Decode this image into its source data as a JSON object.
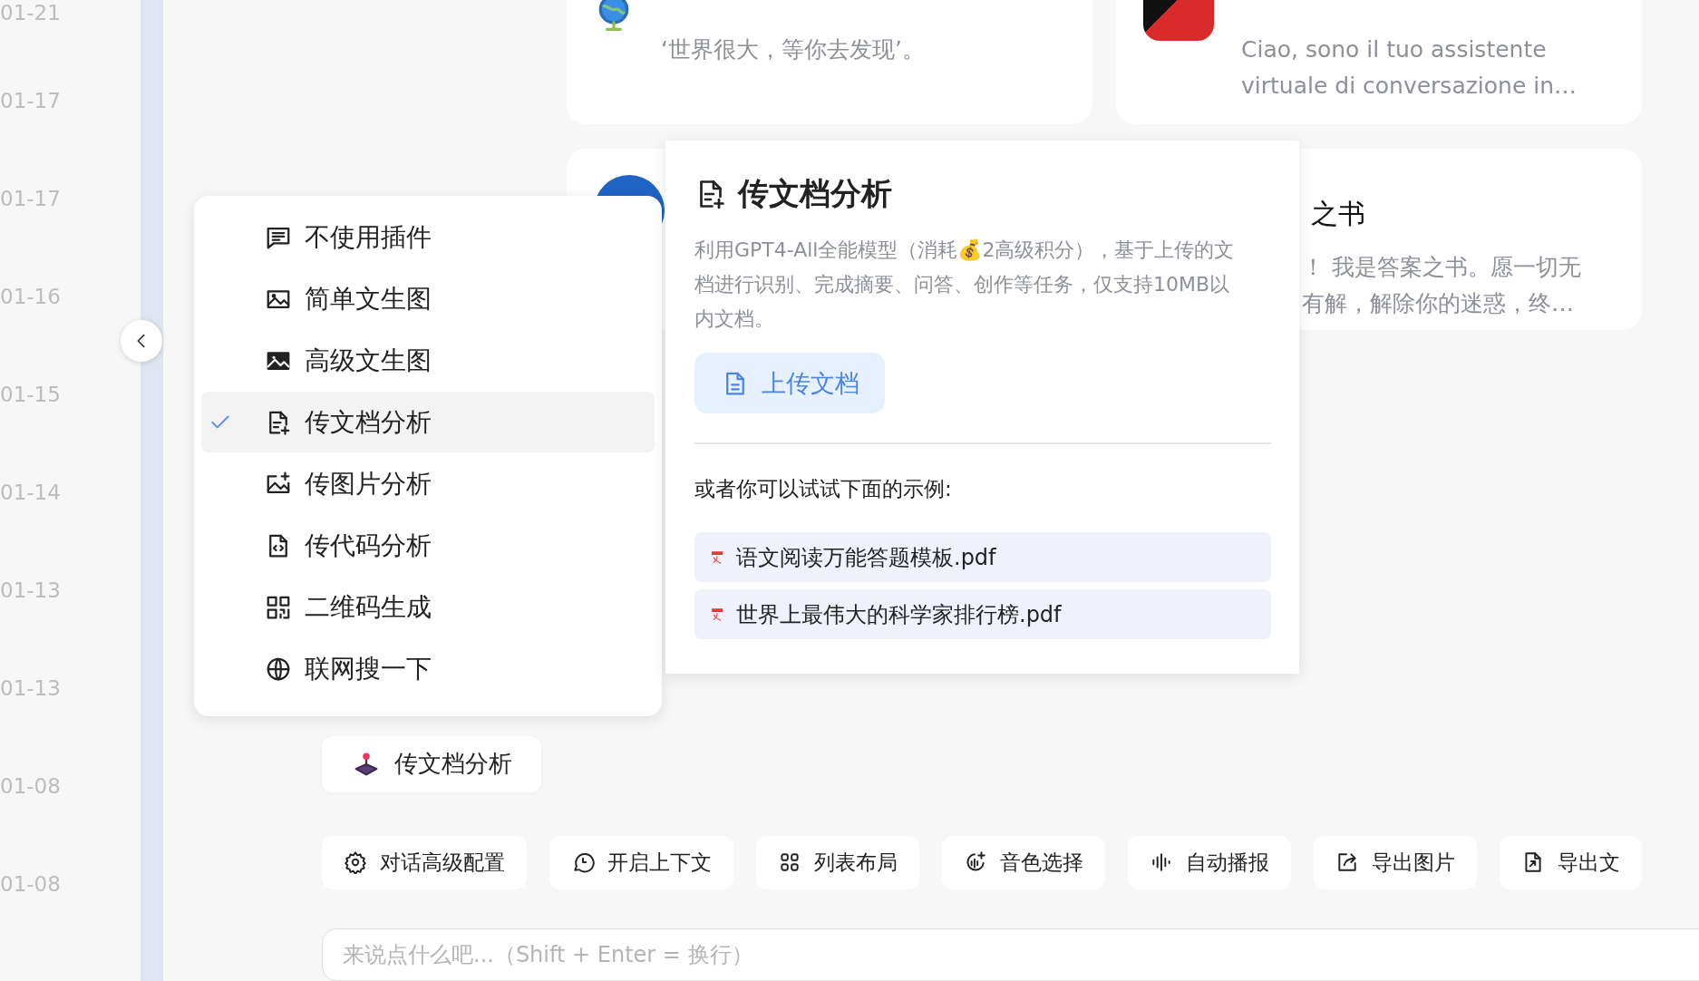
{
  "dates": [
    "01-21",
    "01-17",
    "01-17",
    "01-16",
    "01-15",
    "01-14",
    "01-13",
    "01-13",
    "01-08",
    "01-08"
  ],
  "cards": [
    {
      "kind": "globe",
      "description_lines": [
        "‘世界很大，等你去发现’。"
      ]
    },
    {
      "kind": "app",
      "description_lines": [
        "Ciao, sono il tuo assistente",
        "virtuale di conversazione in…"
      ]
    },
    {
      "kind": "avatar"
    },
    {
      "kind": "text",
      "title": "之书",
      "description_lines": [
        "！ 我是答案之书。愿一切无",
        "有解，解除你的迷惑，终…"
      ]
    }
  ],
  "plugin_menu": {
    "items": [
      {
        "label": "不使用插件",
        "selected": false
      },
      {
        "label": "简单文生图",
        "selected": false
      },
      {
        "label": "高级文生图",
        "selected": false
      },
      {
        "label": "传文档分析",
        "selected": true
      },
      {
        "label": "传图片分析",
        "selected": false
      },
      {
        "label": "传代码分析",
        "selected": false
      },
      {
        "label": "二维码生成",
        "selected": false
      },
      {
        "label": "联网搜一下",
        "selected": false
      }
    ]
  },
  "plugin_detail": {
    "title": "传文档分析",
    "description": "利用GPT4-All全能模型（消耗💰2高级积分），基于上传的文档进行识别、完成摘要、问答、创作等任务，仅支持10MB以内文档。",
    "upload_button": "上传文档",
    "examples_heading": "或者你可以试试下面的示例:",
    "examples": [
      "语文阅读万能答题模板.pdf",
      "世界上最伟大的科学家排行榜.pdf"
    ]
  },
  "current_plugin": "传文档分析",
  "toolbar": [
    "对话高级配置",
    "开启上下文",
    "列表布局",
    "音色选择",
    "自动播报",
    "导出图片",
    "导出文"
  ],
  "input": {
    "placeholder": "来说点什么吧...（Shift + Enter = 换行）"
  }
}
